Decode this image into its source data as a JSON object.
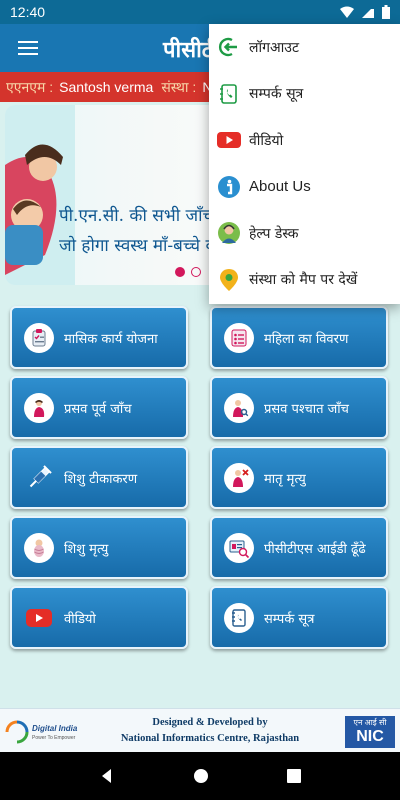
{
  "status_bar": {
    "time": "12:40"
  },
  "app_bar": {
    "title": "पीसीटीएस"
  },
  "ticker": {
    "anm_label": "एएनएम :",
    "anm_value": "Santosh verma",
    "facility_label": "संस्था :",
    "facility_value": "N"
  },
  "banner": {
    "line1": "पी.एन.सी. की सभी जाँच कराएं,",
    "line2": "जो होगा स्वस्थ माँ-बच्चे का उपाय",
    "slides": 2,
    "active_slide": 1
  },
  "tiles": [
    {
      "label": "मासिक कार्य योजना",
      "icon": "clipboard-checklist-icon"
    },
    {
      "label": "महिला का विवरण",
      "icon": "form-list-icon"
    },
    {
      "label": "प्रसव पूर्व जाँच",
      "icon": "pregnant-woman-icon"
    },
    {
      "label": "प्रसव पश्चात जाँच",
      "icon": "mother-checkup-icon"
    },
    {
      "label": "शिशु टीकाकरण",
      "icon": "syringe-icon"
    },
    {
      "label": "मातृ मृत्यु",
      "icon": "maternal-death-icon"
    },
    {
      "label": "शिशु मृत्यु",
      "icon": "swaddled-baby-icon"
    },
    {
      "label": "पीसीटीएस आईडी ढूँढे",
      "icon": "id-search-icon"
    },
    {
      "label": "वीडियो",
      "icon": "youtube-icon"
    },
    {
      "label": "सम्पर्क सूत्र",
      "icon": "contact-book-icon"
    }
  ],
  "menu": [
    {
      "label": "लॉगआउट",
      "icon": "logout-icon"
    },
    {
      "label": "सम्पर्क सूत्र",
      "icon": "contact-phone-icon"
    },
    {
      "label": "वीडियो",
      "icon": "youtube-icon"
    },
    {
      "label": "About Us",
      "icon": "info-icon"
    },
    {
      "label": "हेल्प डेस्क",
      "icon": "help-desk-icon"
    },
    {
      "label": "संस्था को मैप पर देखें",
      "icon": "map-pin-icon"
    }
  ],
  "footer": {
    "logo_text": "Digital India",
    "logo_tagline": "Power To Empower",
    "credit_line1": "Designed & Developed by",
    "credit_line2": "National Informatics Centre, Rajasthan",
    "nic_small": "एन आई सी",
    "nic_big": "NIC"
  },
  "colors": {
    "status_bar": "#0d6a96",
    "app_bar": "#1976b2",
    "ticker": "#d4342c",
    "tile": "#1f7bbd",
    "background": "#d9f1ef",
    "accent": "#d2185c"
  }
}
